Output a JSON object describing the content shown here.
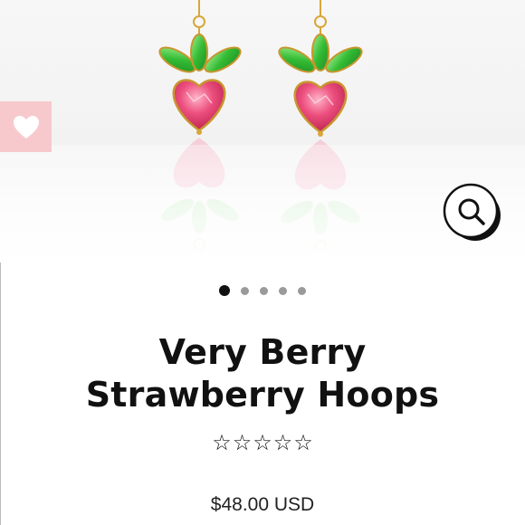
{
  "product": {
    "title_line1": "Very Berry",
    "title_line2": "Strawberry Hoops",
    "price": "$48.00 USD",
    "rating": {
      "stars_filled": 0,
      "stars_total": 5,
      "star_glyph": "☆"
    }
  },
  "gallery": {
    "image_count": 5,
    "active_index": 0,
    "image_name": "strawberry-hoop-earrings-image"
  },
  "icons": {
    "wishlist": "heart-icon",
    "zoom": "search-icon"
  },
  "colors": {
    "wishlist_bg": "#f7c9cd",
    "gem_pink": "#e94a7a",
    "gem_green": "#3cbf3c",
    "gold": "#d8a63a",
    "text": "#111111"
  }
}
